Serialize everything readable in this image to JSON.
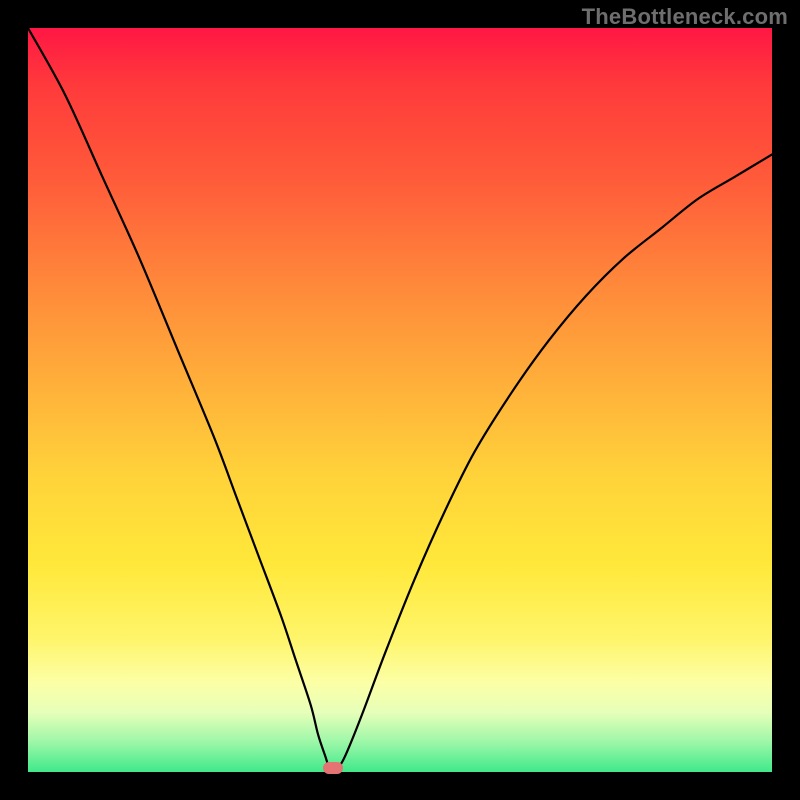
{
  "watermark": "TheBottleneck.com",
  "chart_data": {
    "type": "line",
    "title": "",
    "xlabel": "",
    "ylabel": "",
    "xlim": [
      0,
      100
    ],
    "ylim": [
      0,
      100
    ],
    "series": [
      {
        "name": "bottleneck-curve",
        "x": [
          0,
          5,
          10,
          15,
          20,
          25,
          28,
          31,
          34,
          36,
          38,
          39,
          40,
          40.5,
          41,
          42,
          43,
          45,
          48,
          52,
          56,
          60,
          65,
          70,
          75,
          80,
          85,
          90,
          95,
          100
        ],
        "y": [
          100,
          91,
          80,
          69,
          57,
          45,
          37,
          29,
          21,
          15,
          9,
          5,
          2,
          0.5,
          0.5,
          1,
          3,
          8,
          16,
          26,
          35,
          43,
          51,
          58,
          64,
          69,
          73,
          77,
          80,
          83
        ]
      }
    ],
    "markers": [
      {
        "name": "optimal-point",
        "x": 41,
        "y": 0.5
      }
    ],
    "background_gradient": {
      "top": "#ff1744",
      "middle": "#ffd23a",
      "bottom": "#3fe98a"
    }
  }
}
